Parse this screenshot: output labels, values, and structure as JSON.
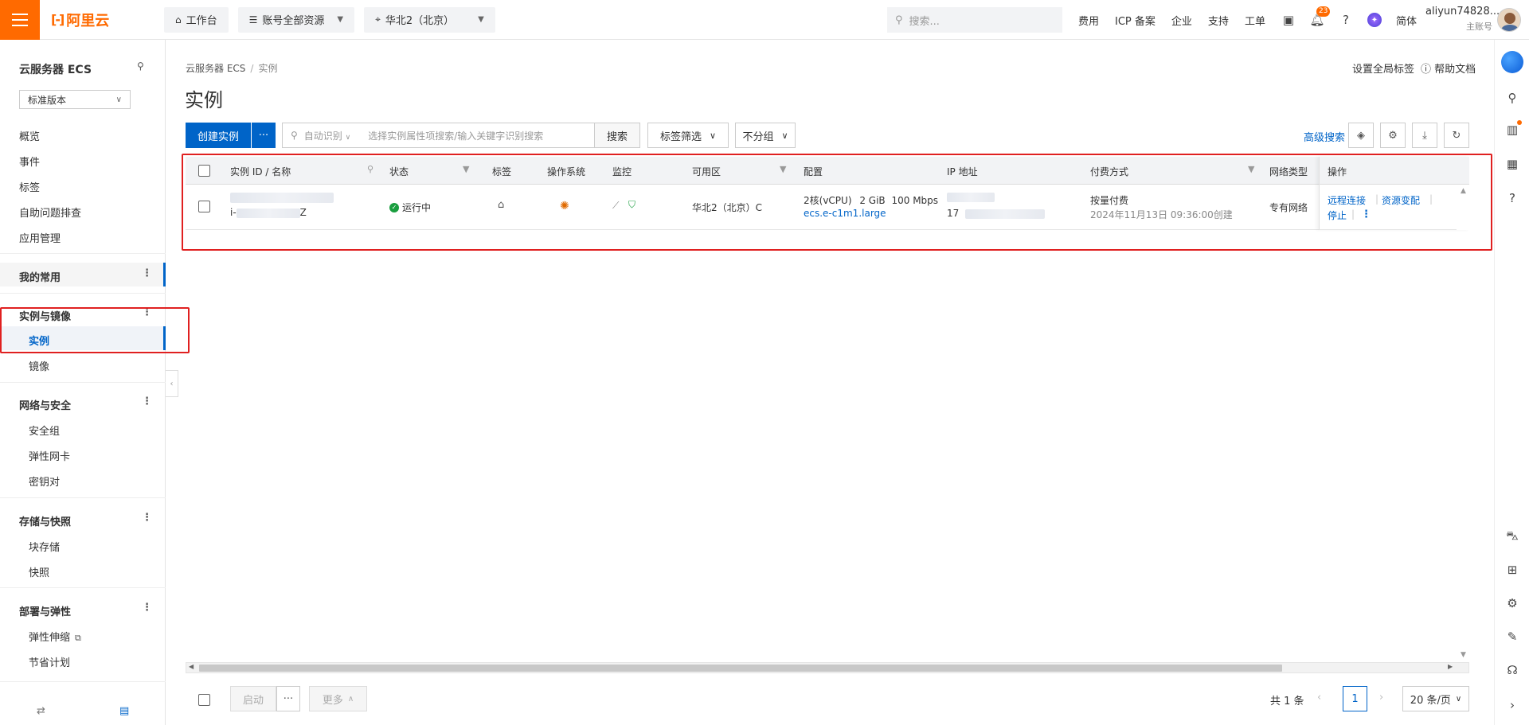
{
  "topbar": {
    "logo_mark": "[-]",
    "logo_text": "阿里云",
    "workbench": "工作台",
    "account_resources": "账号全部资源",
    "region": "华北2（北京）",
    "search_placeholder": "搜索...",
    "links": [
      "费用",
      "ICP 备案",
      "企业",
      "支持",
      "工单"
    ],
    "notification_count": "23",
    "language": "简体",
    "user_name": "aliyun74828...",
    "user_role": "主账号"
  },
  "sidebar": {
    "title": "云服务器 ECS",
    "version": "标准版本",
    "items": [
      "概览",
      "事件",
      "标签",
      "自助问题排查",
      "应用管理"
    ],
    "favorites": "我的常用",
    "groups": [
      {
        "label": "实例与镜像",
        "children": [
          "实例",
          "镜像"
        ]
      },
      {
        "label": "网络与安全",
        "children": [
          "安全组",
          "弹性网卡",
          "密钥对"
        ]
      },
      {
        "label": "存储与快照",
        "children": [
          "块存储",
          "快照"
        ]
      },
      {
        "label": "部署与弹性",
        "children": [
          "弹性伸缩",
          "节省计划"
        ]
      }
    ]
  },
  "main": {
    "breadcrumb": [
      "云服务器 ECS",
      "实例"
    ],
    "title": "实例",
    "global_tags": "设置全局标签",
    "help_docs": "帮助文档",
    "create_button": "创建实例",
    "more_glyph": "···",
    "search_mode": "自动识别",
    "search_placeholder": "选择实例属性项搜索/输入关键字识别搜索",
    "search_button": "搜索",
    "tag_filter": "标签筛选",
    "no_group": "不分组",
    "advanced_search": "高级搜索"
  },
  "table": {
    "columns": [
      "实例 ID / 名称",
      "状态",
      "标签",
      "操作系统",
      "监控",
      "可用区",
      "配置",
      "IP 地址",
      "付费方式",
      "网络类型",
      "操作"
    ],
    "rows": [
      {
        "id_visible_prefix": "i-",
        "id_visible_suffix": "Z",
        "status": "运行中",
        "zone": "华北2（北京）C",
        "config_cpu": "2核(vCPU)",
        "config_mem": "2 GiB",
        "config_bw": "100 Mbps",
        "instance_type": "ecs.e-c1m1.large",
        "ip_prefix": "17",
        "billing": "按量付费",
        "created": "2024年11月13日 09:36:00创建",
        "network": "专有网络",
        "actions": [
          "远程连接",
          "资源变配",
          "停止"
        ]
      }
    ]
  },
  "footer": {
    "start": "启动",
    "more": "更多",
    "total": "共 1 条",
    "page": "1",
    "page_size": "20 条/页"
  },
  "colors": {
    "brand": "#ff6a00",
    "primary": "#0064c8",
    "highlight_box": "#e02020",
    "running": "#1a9e3f"
  }
}
